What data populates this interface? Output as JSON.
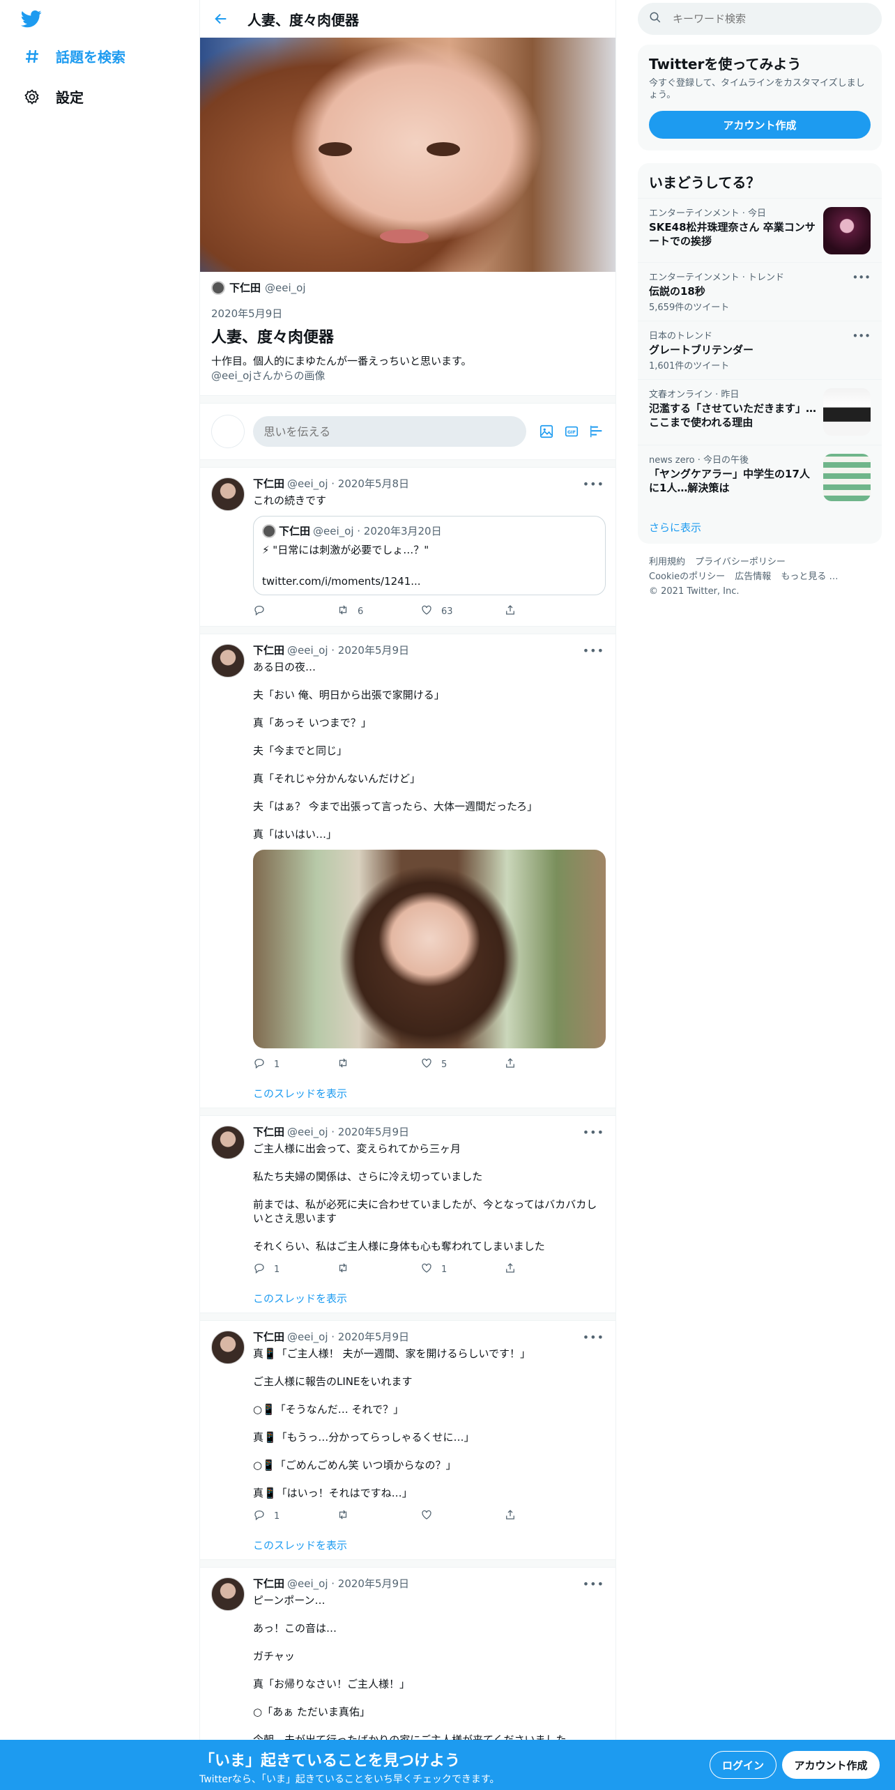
{
  "nav": {
    "explore": "話題を検索",
    "settings": "設定"
  },
  "header": {
    "title": "人妻、度々肉便器"
  },
  "moment": {
    "author_name": "下仁田",
    "author_handle": "@eei_oj",
    "date": "2020年5月9日",
    "title": "人妻、度々肉便器",
    "description": "十作目。個人的にまゆたんが一番えっちいと思います。",
    "credit": "@eei_ojさんからの画像"
  },
  "compose": {
    "placeholder": "思いを伝える"
  },
  "tweets": [
    {
      "name": "下仁田",
      "meta": "@eei_oj · 2020年5月8日",
      "lines": [
        "これの続きです"
      ],
      "quote": {
        "name": "下仁田",
        "meta": "@eei_oj · 2020年3月20日",
        "text": "⚡ \"日常には刺激が必要でしょ…？\"",
        "link": "twitter.com/i/moments/1241..."
      },
      "reply": "",
      "retweet": "6",
      "like": "63"
    },
    {
      "name": "下仁田",
      "meta": "@eei_oj · 2020年5月9日",
      "lines": [
        "ある日の夜…",
        "夫「おい 俺、明日から出張で家開ける」",
        "真「あっそ いつまで？」",
        "夫「今までと同じ」",
        "真「それじゃ分かんないんだけど」",
        "夫「はぁ？ 今まで出張って言ったら、大体一週間だったろ」",
        "真「はいはい…」"
      ],
      "reply": "1",
      "retweet": "",
      "like": "5",
      "thread": "このスレッドを表示"
    },
    {
      "name": "下仁田",
      "meta": "@eei_oj · 2020年5月9日",
      "lines": [
        "ご主人様に出会って、変えられてから三ヶ月",
        "私たち夫婦の関係は、さらに冷え切っていました",
        "前までは、私が必死に夫に合わせていましたが、今となってはバカバカしいとさえ思います",
        "それくらい、私はご主人様に身体も心も奪われてしまいました"
      ],
      "reply": "1",
      "retweet": "",
      "like": "1",
      "thread": "このスレッドを表示"
    },
    {
      "name": "下仁田",
      "meta": "@eei_oj · 2020年5月9日",
      "lines": [
        "真📱「ご主人様！ 夫が一週間、家を開けるらしいです！」",
        "ご主人様に報告のLINEをいれます",
        "○📱「そうなんだ… それで？」",
        "真📱「もうっ…分かってらっしゃるくせに…」",
        "○📱「ごめんごめん笑 いつ頃からなの？」",
        "真📱「はいっ！それはですね…」"
      ],
      "reply": "1",
      "retweet": "",
      "like": "",
      "thread": "このスレッドを表示"
    },
    {
      "name": "下仁田",
      "meta": "@eei_oj · 2020年5月9日",
      "lines": [
        "ピーンポーン…",
        "あっ！この音は…",
        "ガチャッ",
        "真「お帰りなさい！ご主人様！」",
        "○「あぁ ただいま真佑」",
        "今朝、夫が出て行ったばかりの家にご主人様が来てくださいました"
      ]
    }
  ],
  "search": {
    "placeholder": "キーワード検索"
  },
  "signup": {
    "title": "Twitterを使ってみよう",
    "text": "今すぐ登録して、タイムラインをカスタマイズしましょう。",
    "button": "アカウント作成"
  },
  "trends": {
    "title": "いまどうしてる？",
    "items": [
      {
        "meta": "エンターテインメント · 今日",
        "title": "SKE48松井珠理奈さん 卒業コンサートでの挨拶",
        "count": ""
      },
      {
        "meta": "エンターテインメント · トレンド",
        "title": "伝説の18秒",
        "count": "5,659件のツイート"
      },
      {
        "meta": "日本のトレンド",
        "title": "グレートブリテンダー",
        "count": "1,601件のツイート"
      },
      {
        "meta": "文春オンライン · 昨日",
        "title": "氾濫する「させていただきます」…ここまで使われる理由",
        "count": ""
      },
      {
        "meta": "news zero · 今日の午後",
        "title": "「ヤングケアラー」中学生の17人に1人…解決策は",
        "count": ""
      }
    ],
    "show_more": "さらに表示"
  },
  "footer": {
    "links": [
      "利用規約",
      "プライバシーポリシー",
      "Cookieのポリシー",
      "広告情報",
      "もっと見る …"
    ],
    "copyright": "© 2021 Twitter, Inc."
  },
  "bottombar": {
    "title": "「いま」起きていることを見つけよう",
    "subtitle": "Twitterなら、「いま」起きていることをいち早くチェックできます。",
    "login": "ログイン",
    "signup": "アカウント作成"
  },
  "colors": {
    "accent": "#1d9bf0",
    "text": "#0f1419",
    "secondary": "#536471"
  }
}
